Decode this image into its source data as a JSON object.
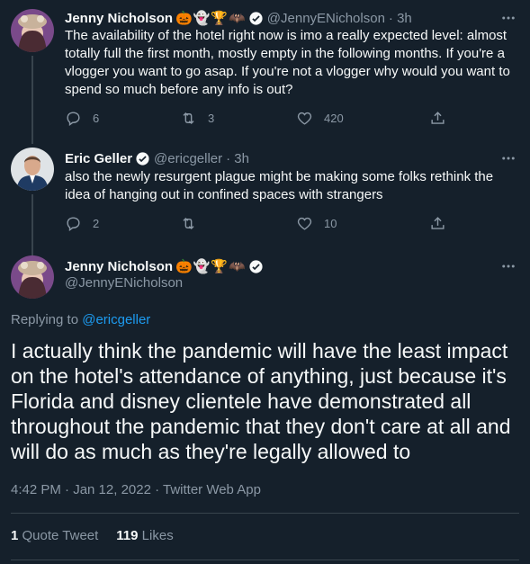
{
  "tweets": [
    {
      "name": "Jenny Nicholson",
      "emoji": [
        "🎃",
        "👻",
        "🏆",
        "🦇"
      ],
      "handle": "@JennyENicholson",
      "time": "· 3h",
      "text": "The availability of the hotel right now is imo a really expected level: almost totally full the first month, mostly empty in the following months. If you're a vlogger you want to go asap. If you're not a vlogger why would you want to spend so much before any info is out?",
      "replies": "6",
      "retweets": "3",
      "likes": "420"
    },
    {
      "name": "Eric Geller",
      "handle": "@ericgeller",
      "time": "· 3h",
      "text": "also the newly resurgent plague might be making some folks rethink the idea of hanging out in confined spaces with strangers",
      "replies": "2",
      "retweets": "",
      "likes": "10"
    }
  ],
  "main": {
    "name": "Jenny Nicholson",
    "emoji": [
      "🎃",
      "👻",
      "🏆",
      "🦇"
    ],
    "handle": "@JennyENicholson",
    "replying_label": "Replying to",
    "replying_to": "@ericgeller",
    "text": "I actually think the pandemic will have the least impact on the hotel's attendance of anything, just because it's Florida and disney clientele have demonstrated all throughout the pandemic that they don't care at all and will do as much as they're legally allowed to",
    "time": "4:42 PM · Jan 12, 2022 · Twitter Web App",
    "quote_count": "1",
    "quote_label": "Quote Tweet",
    "like_count": "119",
    "like_label": "Likes"
  },
  "icons": {
    "reply": "reply-icon",
    "retweet": "retweet-icon",
    "like": "heart-icon",
    "share": "share-icon",
    "more": "more-icon",
    "verified": "verified-icon"
  },
  "colors": {
    "background": "#15202b",
    "text": "#f7f9f9",
    "muted": "#8b98a5",
    "accent": "#1d9bf0",
    "divider": "#38444d"
  }
}
